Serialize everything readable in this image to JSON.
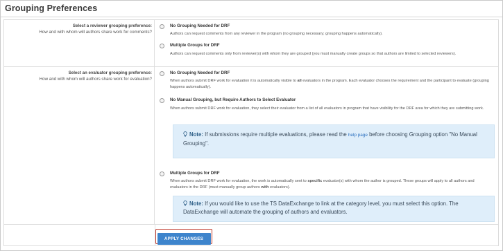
{
  "header": {
    "title": "Grouping Preferences"
  },
  "reviewer": {
    "question_title": "Select a reviewer grouping preference:",
    "question_sub": "How and with whom will authors share work for comments?",
    "options": [
      {
        "title": "No Grouping Needed for DRF",
        "desc": "Authors can request comments from any reviewer in the program (no grouping necessary; grouping happens automatically)."
      },
      {
        "title": "Multiple Groups for DRF",
        "desc": "Authors can request comments only from reviewer(s) with whom they are grouped (you must manually create groups so that authors are limited to selected reviewers)."
      }
    ]
  },
  "evaluator": {
    "question_title": "Select an evaluator grouping preference:",
    "question_sub": "How and with whom will authors share work for evaluation?",
    "options": [
      {
        "title": "No Grouping Needed for DRF",
        "desc_a": "When authors submit DRF work for evaluation it is automatically visible to ",
        "desc_bold": "all",
        "desc_b": " evaluators in the program. Each evaluator chooses the requirement and the participant to evaluate (grouping happens automatically)."
      },
      {
        "title": "No Manual Grouping, but Require Authors to Select Evaluator",
        "desc": "When authors submit DRF work for evaluation, they select their evaluator from a list of all evaluators in program that have visibility for the DRF area for which they are submitting work."
      },
      {
        "title": "Multiple Groups for DRF",
        "desc_a": "When authors submit DRF work for evaluation, the work is automatically sent to ",
        "desc_bold": "specific",
        "desc_b": " evaluator(s) with whom the author is grouped. These groups will apply to all authors and evaluators in the DRF (must manually group authors ",
        "desc_bold2": "with",
        "desc_c": " evaluators)."
      }
    ],
    "note1": {
      "label": "Note:",
      "text_a": " If submissions require multiple evaluations, please read the ",
      "link": "help page",
      "text_b": " before choosing Grouping option \"No Manual Grouping\"."
    },
    "note2": {
      "label": "Note:",
      "text": " If you would like to use the TS DataExchange to link at the category level, you must select this option. The DataExchange will automate the grouping of authors and evaluators."
    }
  },
  "footer": {
    "apply_label": "APPLY CHANGES"
  },
  "colors": {
    "accent": "#3d84cc",
    "highlight_border": "#c0392b",
    "note_bg": "#dfeefa"
  },
  "icons": {
    "note": "lightbulb-icon"
  }
}
